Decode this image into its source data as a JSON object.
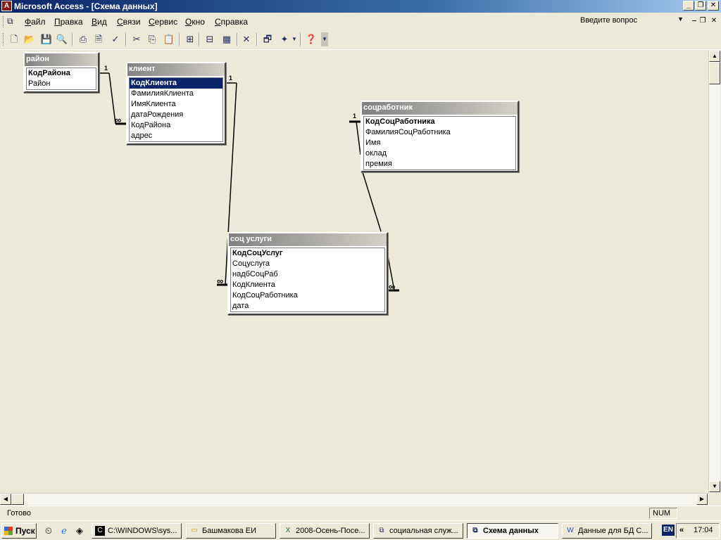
{
  "window": {
    "title": "Microsoft Access - [Схема данных]",
    "min_glyph": "_",
    "max_glyph": "❐",
    "close_glyph": "✕"
  },
  "menu": {
    "items": [
      "Файл",
      "Правка",
      "Вид",
      "Связи",
      "Сервис",
      "Окно",
      "Справка"
    ],
    "ask_placeholder": "Введите вопрос"
  },
  "tables": {
    "rayon": {
      "title": "район",
      "fields": [
        "КодРайона",
        "Район"
      ]
    },
    "klient": {
      "title": "клиент",
      "fields": [
        "КодКлиента",
        "ФамилияКлиента",
        "ИмяКлиента",
        "датаРождения",
        "КодРайона",
        "адрес"
      ]
    },
    "socrabotnik": {
      "title": "соцработник",
      "fields": [
        "КодСоцРаботника",
        "ФамилияСоцРаботника",
        "Имя",
        "оклад",
        "премия"
      ]
    },
    "socuslugi": {
      "title": "соц услуги",
      "fields": [
        "КодСоцУслуг",
        "Соцуслуга",
        "надбСоцРаб",
        "КодКлиента",
        "КодСоцРаботника",
        "дата"
      ]
    }
  },
  "relations": {
    "one_label": "1",
    "many_label": "∞"
  },
  "status": {
    "text": "Готово",
    "num": "NUM"
  },
  "taskbar": {
    "start": "Пуск",
    "tasks": [
      "C:\\WINDOWS\\sys...",
      "Башмакова ЕИ",
      "2008-Осень-Посе...",
      "социальная служ...",
      "Схема данных",
      "Данные для БД С..."
    ],
    "lang": "EN",
    "chevron": "«",
    "clock": "17:04"
  }
}
